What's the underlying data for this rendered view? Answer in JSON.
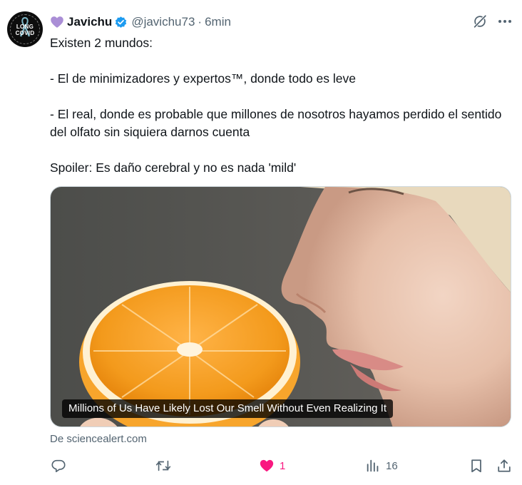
{
  "author": {
    "emoji": "purple-heart",
    "name": "Javichu",
    "handle": "@javichu73",
    "separator": "·",
    "time": "6min",
    "avatar_text": [
      "LONG",
      "COVID"
    ]
  },
  "tweet": {
    "lines": [
      "Existen 2 mundos:",
      "- El de minimizadores y expertos™, donde todo es leve",
      "- El real, donde es probable que millones de nosotros hayamos perdido el sentido del olfato sin siquiera darnos cuenta",
      "Spoiler: Es daño cerebral y no es nada 'mild'"
    ]
  },
  "card": {
    "caption": "Millions of Us Have Likely Lost Our Smell Without Even Realizing It",
    "source": "De sciencealert.com"
  },
  "actions": {
    "reply_count": "",
    "retweet_count": "",
    "like_count": "1",
    "views_count": "16"
  },
  "colors": {
    "like_pink": "#f91880",
    "verified_blue": "#1d9bf0",
    "muted_text": "#536471",
    "emoji_purple": "#aa8ed6"
  },
  "icons": [
    "purple-heart-emoji",
    "verified-badge-icon",
    "grok-icon",
    "more-icon",
    "reply-icon",
    "retweet-icon",
    "like-icon",
    "views-icon",
    "bookmark-icon",
    "share-icon"
  ]
}
